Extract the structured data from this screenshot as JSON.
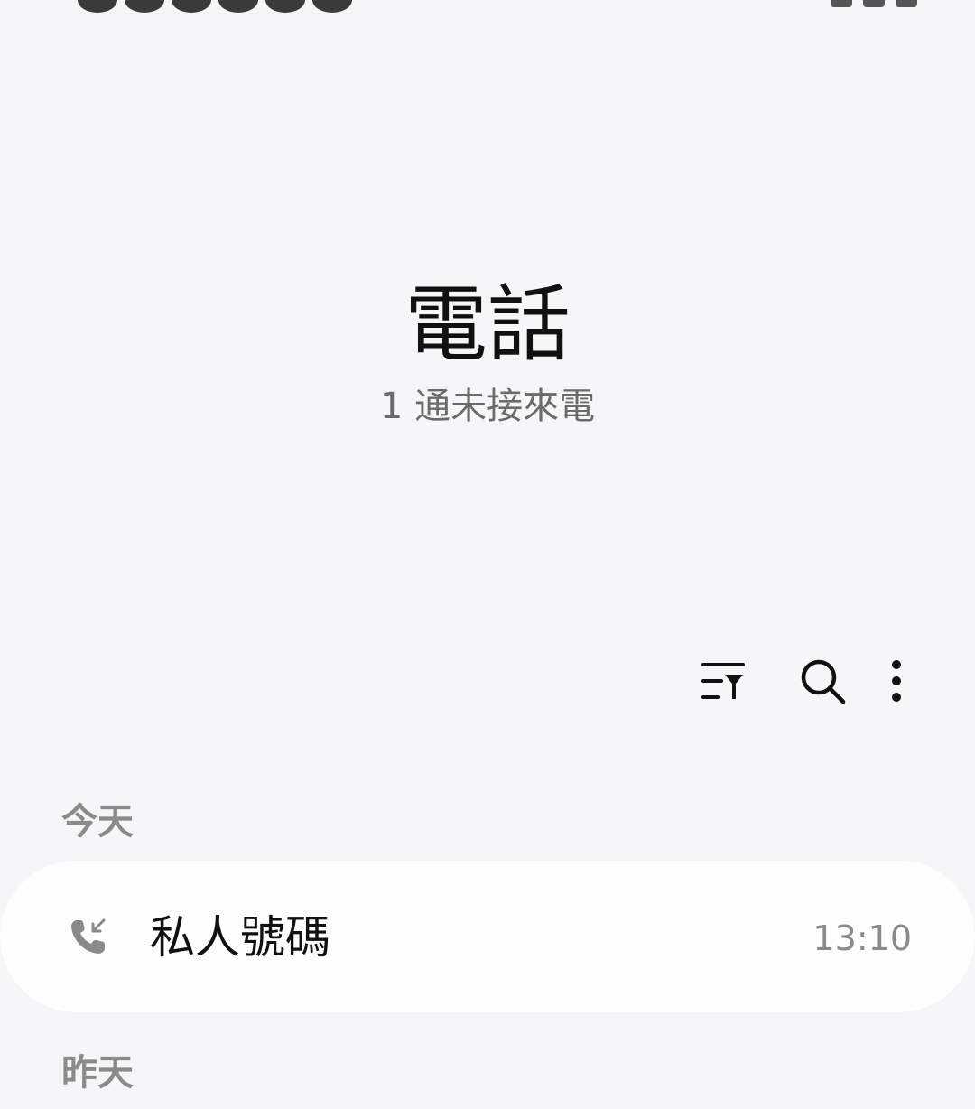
{
  "header": {
    "title": "電話",
    "subtitle": "1 通未接來電"
  },
  "toolbar": {
    "icons": [
      "filter-icon",
      "search-icon",
      "more-vertical-icon"
    ]
  },
  "sections": {
    "today_label": "今天",
    "yesterday_label": "昨天"
  },
  "calls": [
    {
      "name": "私人號碼",
      "time": "13:10",
      "icon": "incoming-call-icon"
    }
  ],
  "colors": {
    "background": "#f6f6f8",
    "card": "#fdfdfe",
    "secondary_text": "#8a8a8a"
  }
}
